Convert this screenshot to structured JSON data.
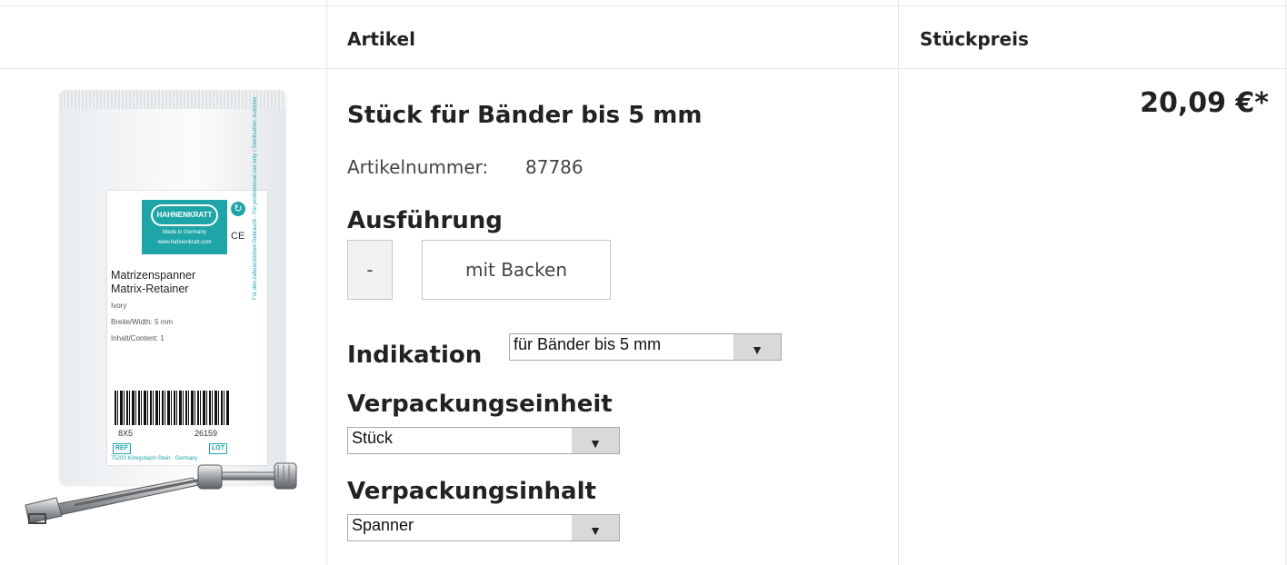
{
  "table": {
    "headers": {
      "article": "Artikel",
      "unit_price": "Stückpreis"
    }
  },
  "product": {
    "title": "Stück für Bänder bis 5 mm",
    "article_number_label": "Artikelnummer:",
    "article_number": "87786",
    "price": "20,09 €*",
    "image": {
      "brand": "HAHNENKRATT",
      "brand_sub_1": "Made in Germany",
      "brand_sub_2": "www.hahnenkratt.com",
      "ce_mark": "CE",
      "name_de": "Matrizenspanner",
      "name_en": "Matrix-Retainer",
      "color": "Ivory",
      "width": "Breite/Width: 5 mm",
      "content": "Inhalt/Content: 1",
      "barcode_left": "8X5",
      "barcode_right": "26159",
      "ref": "REF",
      "lot": "LOT",
      "address": "75203 Königsbach-Stein · Germany",
      "side_text": "Für den zahnärztlichen Gebrauch · For professional use only / Sterilisation: Autoclav"
    }
  },
  "options": {
    "ausfuehrung": {
      "heading": "Ausführung",
      "choices": [
        "-",
        "mit Backen"
      ]
    },
    "indikation": {
      "heading": "Indikation",
      "selected": "für Bänder bis 5 mm"
    },
    "verpackungseinheit": {
      "heading": "Verpackungseinheit",
      "selected": "Stück"
    },
    "verpackungsinhalt": {
      "heading": "Verpackungsinhalt",
      "selected": "Spanner"
    },
    "arrow_glyph": "▼"
  }
}
